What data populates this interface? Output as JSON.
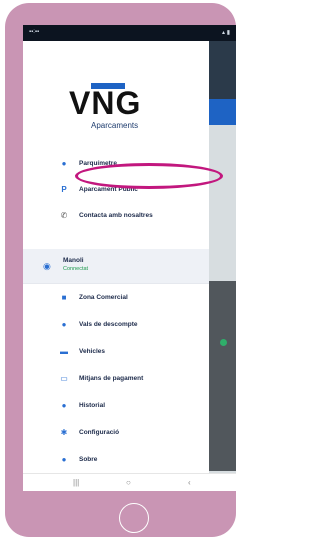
{
  "app": {
    "brand": "VNG",
    "subtitle": "Aparcaments"
  },
  "menu_top": [
    {
      "label": "Parquímetre",
      "icon": "location-pin-icon"
    },
    {
      "label": "Aparcament Públic",
      "icon": "parking-icon"
    },
    {
      "label": "Contacta amb nosaltres",
      "icon": "phone-icon"
    }
  ],
  "user": {
    "name": "Manoli",
    "status": "Connectat"
  },
  "menu_bottom": [
    {
      "label": "Zona Comercial",
      "icon": "shop-icon"
    },
    {
      "label": "Vals de descompte",
      "icon": "coupon-icon"
    },
    {
      "label": "Vehicles",
      "icon": "car-icon"
    },
    {
      "label": "Mitjans de pagament",
      "icon": "card-icon"
    },
    {
      "label": "Historial",
      "icon": "history-icon"
    },
    {
      "label": "Configuració",
      "icon": "settings-icon"
    },
    {
      "label": "Sobre",
      "icon": "info-icon"
    }
  ],
  "colors": {
    "accent": "#2a6fd2",
    "highlight": "#c2177e",
    "phone": "#c995b4"
  }
}
